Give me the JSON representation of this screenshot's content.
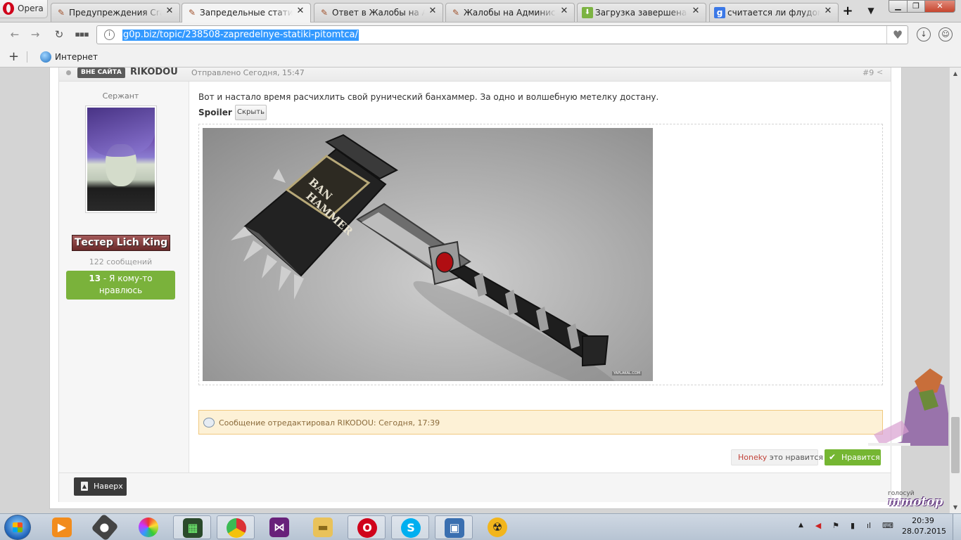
{
  "browser": {
    "menu_label": "Opera",
    "tabs": [
      {
        "title": "Предупреждения CrazyGoat",
        "icon": "forum-favicon"
      },
      {
        "title": "Запредельные статики питомца",
        "icon": "forum-favicon"
      },
      {
        "title": "Ответ в Жалобы на Администрацию",
        "icon": "forum-favicon"
      },
      {
        "title": "Жалобы на Администрацию",
        "icon": "forum-favicon"
      },
      {
        "title": "Загрузка завершена - Быстрая",
        "icon": "download-favicon"
      },
      {
        "title": "считается ли флудом один",
        "icon": "google-favicon"
      }
    ],
    "active_tab": 1,
    "address": "g0p.biz/topic/238508-zapredelnye-statiki-pitomtca/",
    "bookmarks": [
      {
        "label": "Интернет",
        "icon": "globe-icon"
      }
    ]
  },
  "post": {
    "status_badge": "ВНЕ САЙТА",
    "author": "RIKODOU",
    "date": "Отправлено Сегодня, 15:47",
    "number": "#9",
    "author_info": {
      "rank": "Сержант",
      "group": "Тестер Lich King",
      "post_count": "122 сообщений",
      "reputation_count": "13",
      "reputation_text": "- Я кому-то нравлюсь"
    },
    "text": "Вот и настало время расчихлить свой рунический банхаммер. За одно и волшебную метелку достану.",
    "spoiler_label": "Spoiler",
    "spoiler_toggle": "Скрыть",
    "image_text": [
      "BAN",
      "HAMMER"
    ],
    "image_watermark": "YAPLAKAL.COM",
    "edit_notice": "Сообщение отредактировал RIKODOU: Сегодня, 17:39",
    "likes": {
      "user": "Honeky",
      "text": "это нравится"
    },
    "like_button": "Нравится",
    "to_top": "Наверх"
  },
  "ad": {
    "caption": "голосуй",
    "logo": "mmotop"
  },
  "taskbar": {
    "apps": [
      "media-player-icon",
      "microphone-icon",
      "disc-icon",
      "monitor-icon",
      "chrome-icon",
      "visual-studio-icon",
      "file-explorer-icon",
      "opera-icon",
      "skype-icon",
      "remote-desktop-icon",
      "radiation-icon"
    ],
    "time": "20:39",
    "date": "28.07.2015"
  },
  "colors": {
    "like_green": "#75b632",
    "rep_green": "#7ab23b",
    "edit_bg": "#fdf1d6",
    "url_highlight": "#3399ff"
  }
}
